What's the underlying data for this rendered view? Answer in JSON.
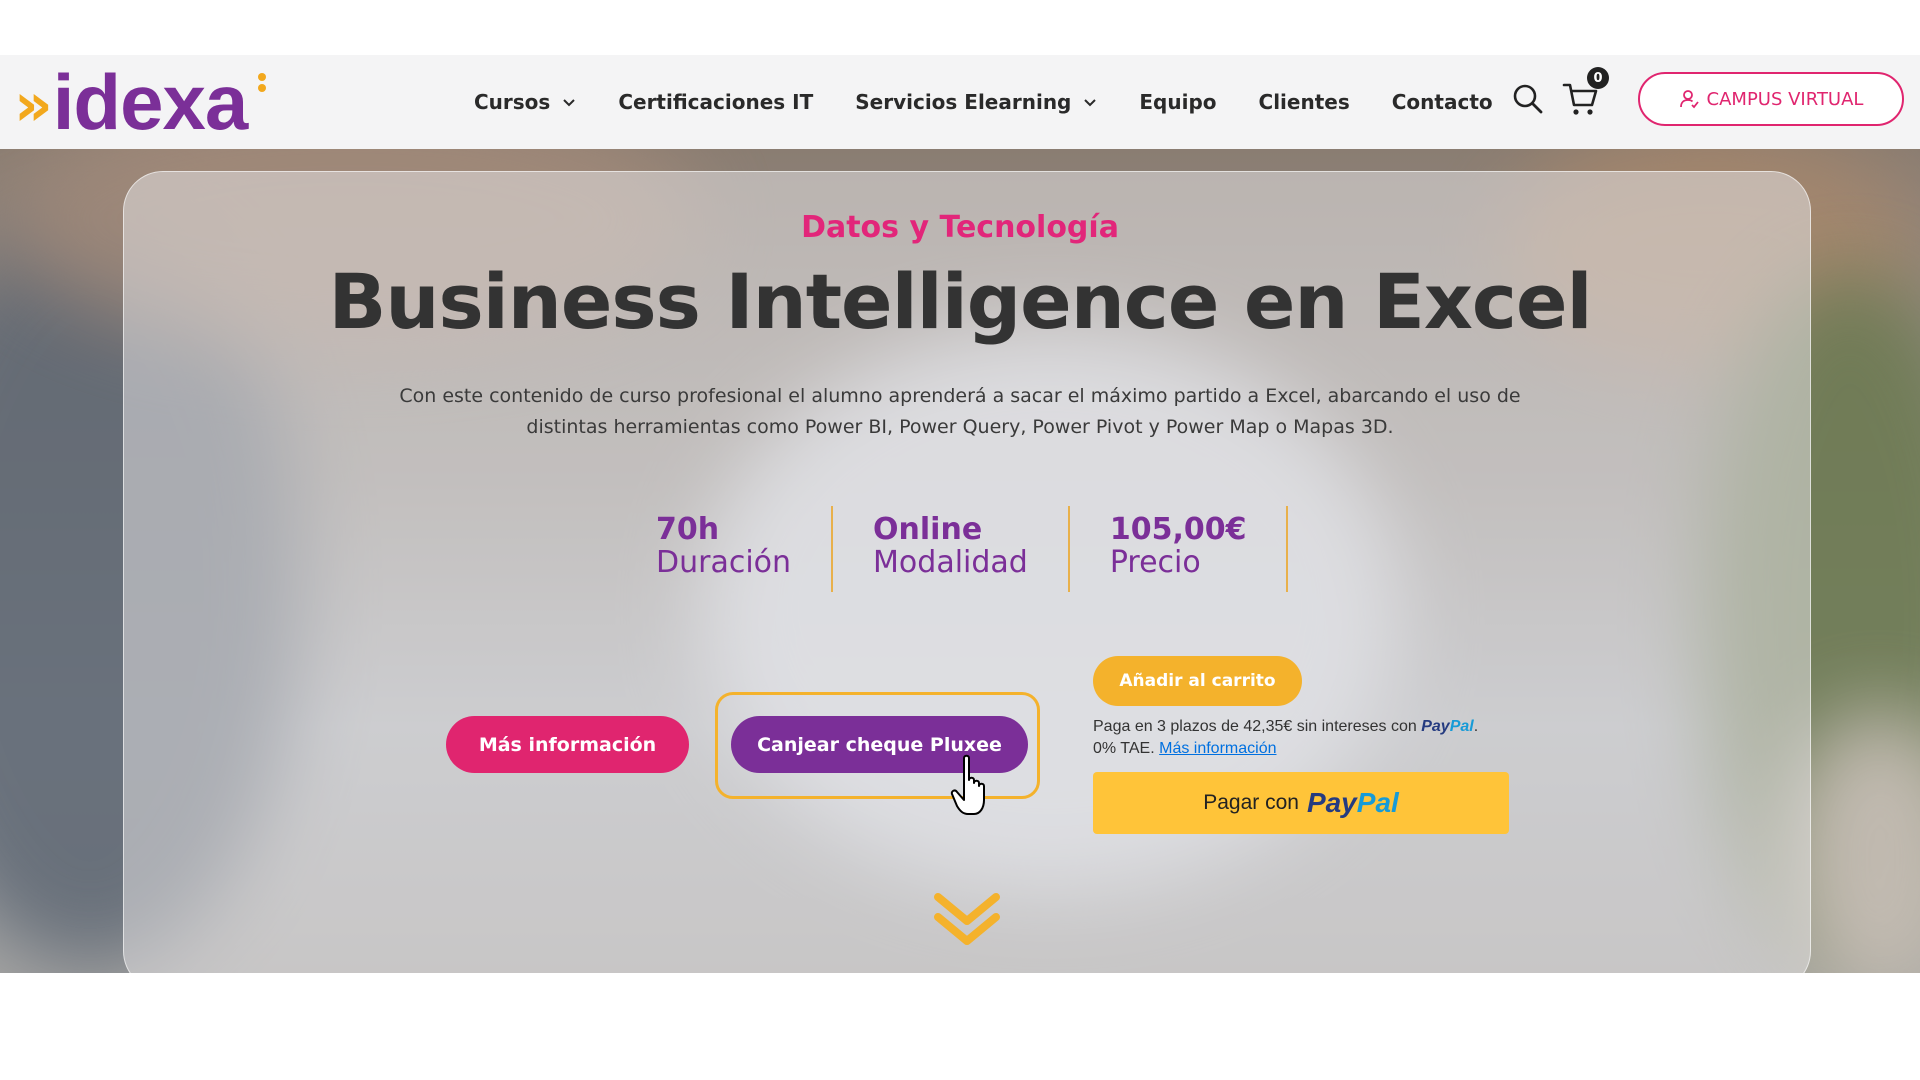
{
  "header": {
    "logo_text": "idexa",
    "nav": [
      {
        "label": "Cursos",
        "has_dropdown": true
      },
      {
        "label": "Certificaciones IT",
        "has_dropdown": false
      },
      {
        "label": "Servicios Elearning",
        "has_dropdown": true
      },
      {
        "label": "Equipo",
        "has_dropdown": false
      },
      {
        "label": "Clientes",
        "has_dropdown": false
      },
      {
        "label": "Contacto",
        "has_dropdown": false
      }
    ],
    "search_icon": "search-icon",
    "cart_icon": "cart-icon",
    "cart_count": "0",
    "campus_button": "CAMPUS VIRTUAL"
  },
  "hero": {
    "category": "Datos y Tecnología",
    "title": "Business Intelligence en Excel",
    "description": "Con este contenido de curso profesional el alumno aprenderá a sacar el máximo partido a Excel, abarcando el uso de distintas herramientas como Power BI, Power Query, Power Pivot y Power Map o Mapas 3D.",
    "stats": [
      {
        "value": "70h",
        "label": "Duración"
      },
      {
        "value": "Online",
        "label": "Modalidad"
      },
      {
        "value": "105,00€",
        "label": "Precio"
      }
    ],
    "more_info_button": "Más información",
    "redeem_button": "Canjear cheque Pluxee",
    "add_to_cart_button": "Añadir al carrito",
    "paypal_installments_text": "Paga en 3 plazos de 42,35€ sin intereses con",
    "paypal_brand_a": "Pay",
    "paypal_brand_b": "Pal",
    "paypal_tae_text": "0% TAE.",
    "paypal_more_info_link": "Más información",
    "paypal_button_prefix": "Pagar con"
  },
  "colors": {
    "brand_purple": "#7b2f98",
    "brand_pink": "#e0256f",
    "brand_yellow": "#f4b22c",
    "paypal_yellow": "#ffc439"
  }
}
